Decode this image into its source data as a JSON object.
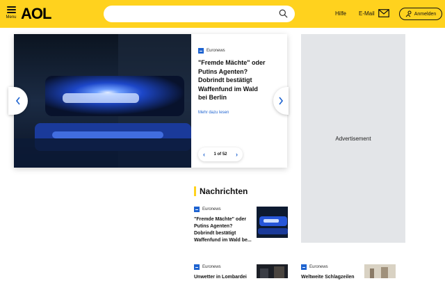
{
  "header": {
    "menu_label": "Menu",
    "logo": "AOL",
    "search_placeholder": "",
    "help_label": "Hilfe",
    "email_label": "E-Mail",
    "login_label": "Anmelden"
  },
  "hero": {
    "source": "Euronews",
    "title": "\"Fremde Mächte\" oder Putins Agenten? Dobrindt bestätigt Waffenfund im Wald bei Berlin",
    "read_more": "Mehr dazu lesen",
    "pager": "1 of 52"
  },
  "ad": {
    "label": "Advertisement"
  },
  "news": {
    "section_title": "Nachrichten",
    "items": [
      {
        "source": "Euronews",
        "title": "\"Fremde Mächte\" oder Putins Agenten? Dobrindt bestätigt Waffenfund im Wald be..."
      },
      {
        "source": "Euronews",
        "title": "Unwetter in Lombardei"
      },
      {
        "source": "Euronews",
        "title": "Weltweite Schlagzeilen"
      }
    ]
  },
  "colors": {
    "brand_yellow": "#ffd21e",
    "link_blue": "#1e63d0",
    "ad_gray": "#e3e5e8"
  }
}
